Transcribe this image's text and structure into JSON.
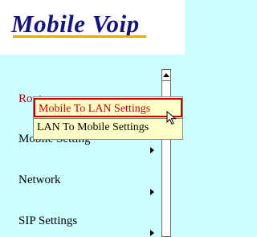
{
  "app": {
    "logo": "Mobile Voip"
  },
  "menu": {
    "items": [
      {
        "label": "Route"
      },
      {
        "label": "Mobile Setting"
      },
      {
        "label": "Network"
      },
      {
        "label": "SIP Settings"
      }
    ]
  },
  "submenu": {
    "items": [
      {
        "label": "Mobile To LAN Settings"
      },
      {
        "label": "LAN To Mobile Settings"
      }
    ]
  },
  "colors": {
    "background": "#ccffff",
    "logo": "#14147a",
    "accent_red": "#c00000",
    "submenu_bg": "#ffffc8"
  }
}
